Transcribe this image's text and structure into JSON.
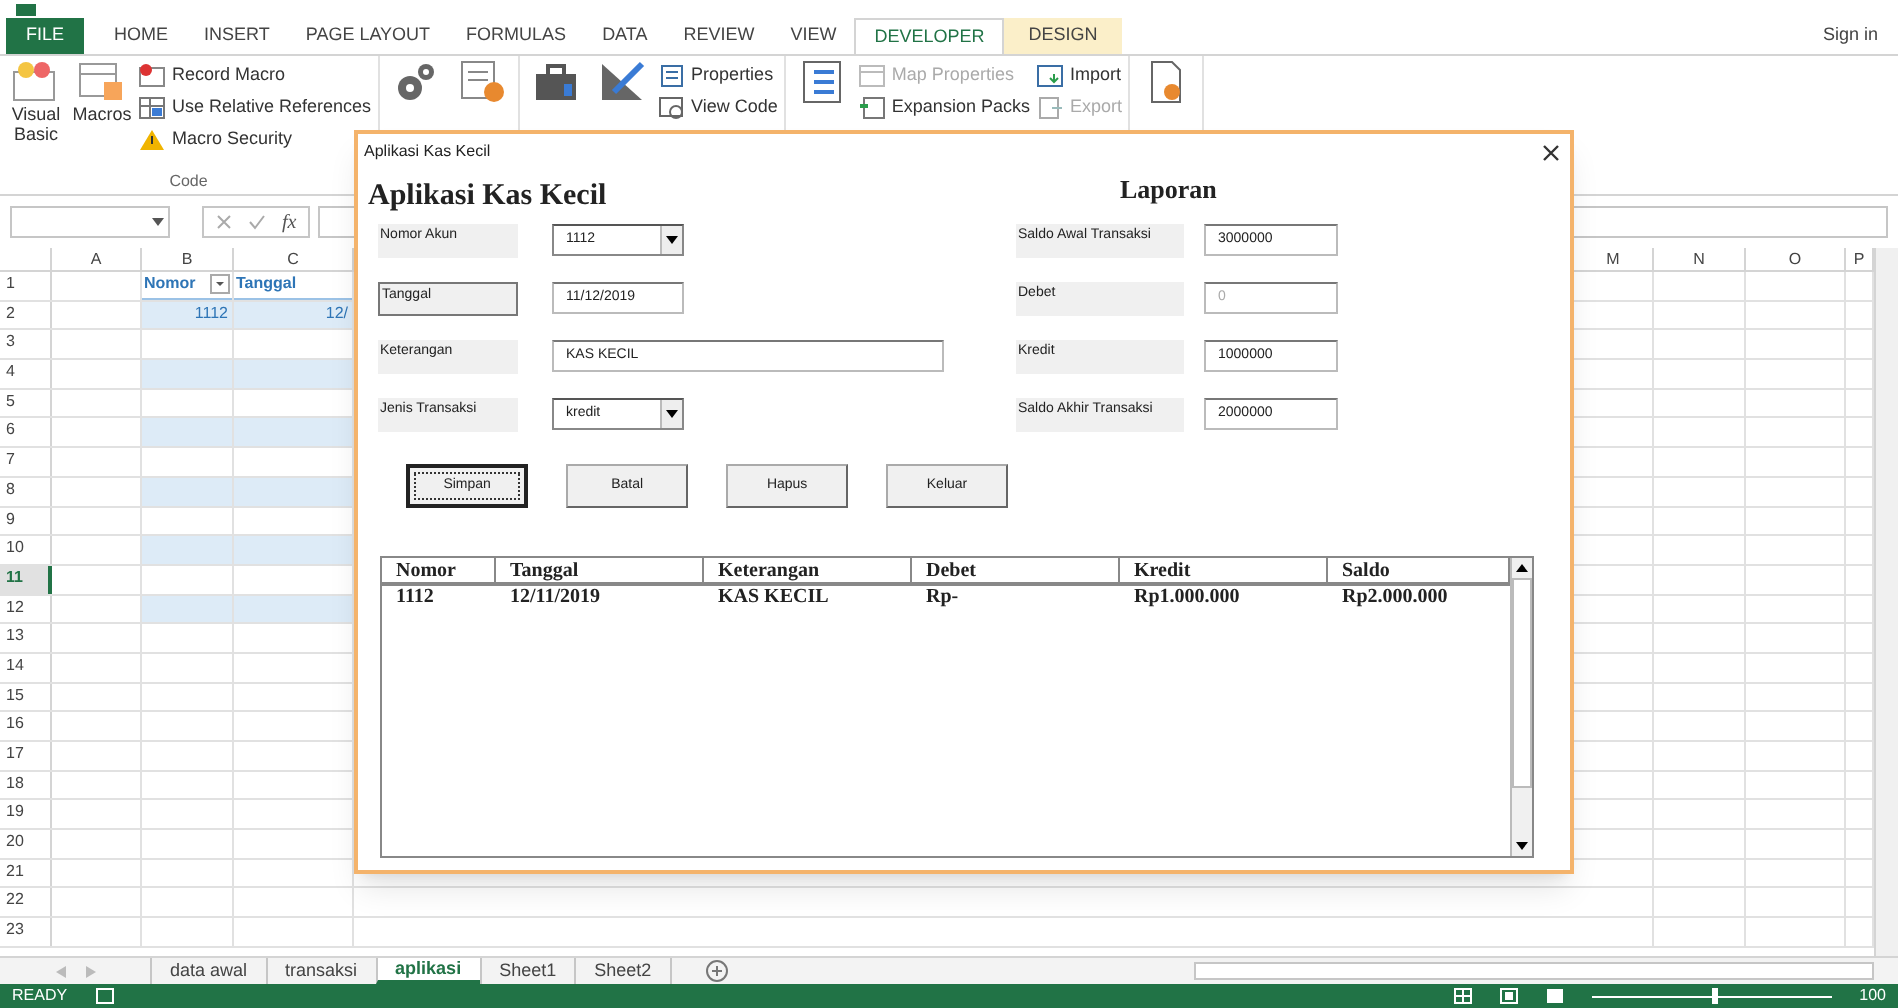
{
  "ribbon": {
    "tabs": [
      {
        "label": "FILE",
        "kind": "file",
        "selected": false
      },
      {
        "label": "HOME",
        "kind": "tab",
        "selected": false
      },
      {
        "label": "INSERT",
        "kind": "tab",
        "selected": false
      },
      {
        "label": "PAGE LAYOUT",
        "kind": "tab",
        "selected": false
      },
      {
        "label": "FORMULAS",
        "kind": "tab",
        "selected": false
      },
      {
        "label": "DATA",
        "kind": "tab",
        "selected": false
      },
      {
        "label": "REVIEW",
        "kind": "tab",
        "selected": false
      },
      {
        "label": "VIEW",
        "kind": "tab",
        "selected": false
      },
      {
        "label": "DEVELOPER",
        "kind": "tab",
        "selected": true
      },
      {
        "label": "DESIGN",
        "kind": "contextual",
        "selected": false
      }
    ],
    "sign_in": "Sign in",
    "groups": [
      {
        "label": "Code",
        "items": [
          {
            "kind": "large",
            "label": "Visual Basic"
          },
          {
            "kind": "large",
            "label": "Macros"
          },
          {
            "kind": "small",
            "label": "Record Macro",
            "disabled": false
          },
          {
            "kind": "small",
            "label": "Use Relative References",
            "disabled": false
          },
          {
            "kind": "small",
            "label": "Macro Security",
            "disabled": false
          }
        ]
      },
      {
        "items": [
          {
            "kind": "large"
          },
          {
            "kind": "large"
          }
        ]
      },
      {
        "items": [
          {
            "kind": "large"
          },
          {
            "kind": "large"
          },
          {
            "kind": "small",
            "label": "Properties",
            "disabled": false
          },
          {
            "kind": "small",
            "label": "View Code",
            "disabled": false
          }
        ]
      },
      {
        "items": [
          {
            "kind": "large"
          },
          {
            "kind": "small",
            "label": "Map Properties",
            "disabled": true
          },
          {
            "kind": "small",
            "label": "Expansion Packs",
            "disabled": false
          },
          {
            "kind": "small",
            "label": "Import",
            "disabled": false
          },
          {
            "kind": "small",
            "label": "Export",
            "disabled": true
          }
        ]
      },
      {
        "items": [
          {
            "kind": "large"
          }
        ]
      }
    ]
  },
  "formula_bar": {
    "function_label": "fx"
  },
  "sheet": {
    "columns": [
      "A",
      "B",
      "C",
      "M",
      "N",
      "O",
      "P"
    ],
    "rows": [
      {
        "label": "1",
        "selected": false
      },
      {
        "label": "2",
        "selected": false
      },
      {
        "label": "3",
        "selected": false
      },
      {
        "label": "4",
        "selected": false
      },
      {
        "label": "5",
        "selected": false
      },
      {
        "label": "6",
        "selected": false
      },
      {
        "label": "7",
        "selected": false
      },
      {
        "label": "8",
        "selected": false
      },
      {
        "label": "9",
        "selected": false
      },
      {
        "label": "10",
        "selected": false
      },
      {
        "label": "11",
        "selected": true
      },
      {
        "label": "12",
        "selected": false
      },
      {
        "label": "13",
        "selected": false
      },
      {
        "label": "14",
        "selected": false
      },
      {
        "label": "15",
        "selected": false
      },
      {
        "label": "16",
        "selected": false
      },
      {
        "label": "17",
        "selected": false
      },
      {
        "label": "18",
        "selected": false
      },
      {
        "label": "19",
        "selected": false
      },
      {
        "label": "20",
        "selected": false
      },
      {
        "label": "21",
        "selected": false
      },
      {
        "label": "22",
        "selected": false
      },
      {
        "label": "23",
        "selected": false
      }
    ],
    "table": {
      "headers": [
        {
          "label": "Nomor",
          "filter": true
        },
        {
          "label": "Tanggal",
          "filter": false
        }
      ],
      "rows": [
        [
          "1112",
          "12/"
        ]
      ]
    }
  },
  "dialog": {
    "title": "Aplikasi Kas Kecil",
    "heading": "Aplikasi Kas Kecil",
    "report_heading": "Laporan",
    "left_fields": [
      {
        "label": "Nomor Akun",
        "framed": false,
        "kind": "combo",
        "value": "1112"
      },
      {
        "label": "Tanggal",
        "framed": true,
        "kind": "text",
        "value": "11/12/2019"
      },
      {
        "label": "Keterangan",
        "framed": false,
        "kind": "long_text",
        "value": "KAS KECIL"
      },
      {
        "label": "Jenis Transaksi",
        "framed": false,
        "kind": "combo",
        "value": "kredit"
      }
    ],
    "right_fields": [
      {
        "label": "Saldo Awal Transaksi",
        "value": "3000000",
        "disabled": false
      },
      {
        "label": "Debet",
        "value": "0",
        "disabled": true
      },
      {
        "label": "Kredit",
        "value": "1000000",
        "disabled": false
      },
      {
        "label": "Saldo Akhir Transaksi",
        "value": "2000000",
        "disabled": false
      }
    ],
    "buttons": [
      {
        "label": "Simpan",
        "focused": true
      },
      {
        "label": "Batal",
        "focused": false
      },
      {
        "label": "Hapus",
        "focused": false
      },
      {
        "label": "Keluar",
        "focused": false
      }
    ],
    "list": {
      "columns": [
        "Nomor",
        "Tanggal",
        "Keterangan",
        "Debet",
        "Kredit",
        "Saldo"
      ],
      "rows": [
        [
          "1112",
          "12/11/2019",
          "KAS KECIL",
          "Rp-",
          "Rp1.000.000",
          "Rp2.000.000"
        ]
      ]
    }
  },
  "sheet_tabs": [
    {
      "label": "data awal",
      "selected": false
    },
    {
      "label": "transaksi",
      "selected": false
    },
    {
      "label": "aplikasi",
      "selected": true
    },
    {
      "label": "Sheet1",
      "selected": false
    },
    {
      "label": "Sheet2",
      "selected": false
    }
  ],
  "status_bar": {
    "status": "READY",
    "zoom": {
      "level": 0.5
    },
    "zoom_label": "100"
  }
}
